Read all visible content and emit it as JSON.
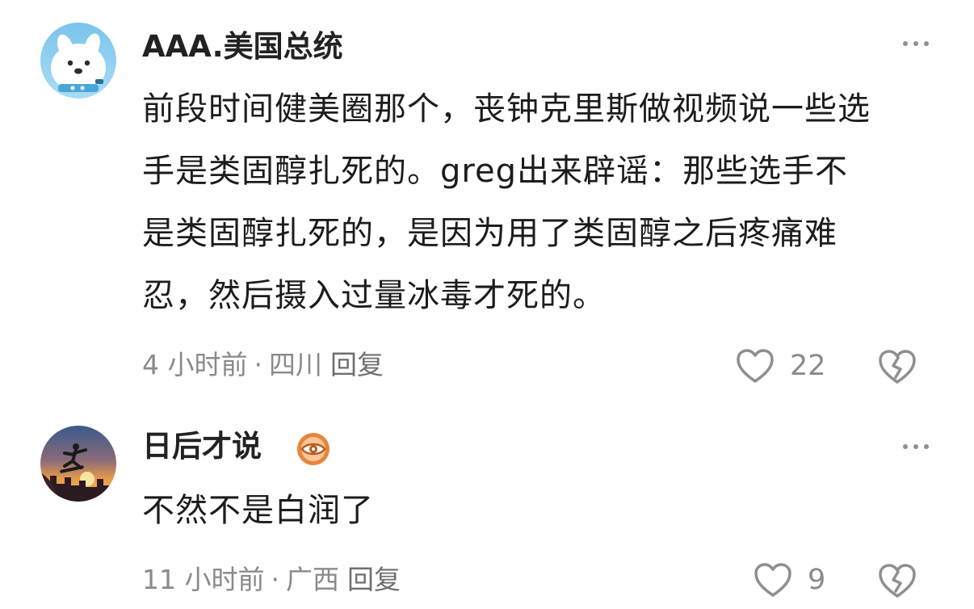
{
  "comments": [
    {
      "username": "AAA.美国总统",
      "avatar_icon": "cartoon-dog-avatar",
      "content": "前段时间健美圈那个，丧钟克里斯做视频说一些选\n手是类固醇扎死的。greg出来辟谣：那些选手不\n是类固醇扎死的，是因为用了类固醇之后疼痛难\n忍，然后摄入过量冰毒才死的。",
      "time": "4 小时前",
      "location": "四川",
      "reply_label": "回复",
      "likes": "22"
    },
    {
      "username": "日后才说",
      "avatar_icon": "skateboarder-sunset-avatar",
      "badge_icon": "eye-badge-icon",
      "content": "不然不是白润了",
      "time": "11 小时前",
      "location": "广西",
      "reply_label": "回复",
      "likes": "9"
    }
  ],
  "separator": "·",
  "colors": {
    "text_primary": "#1c1c1c",
    "text_secondary": "#8a8a8a",
    "icon_gray": "#8f8f8f",
    "badge_orange": "#e8843c"
  }
}
